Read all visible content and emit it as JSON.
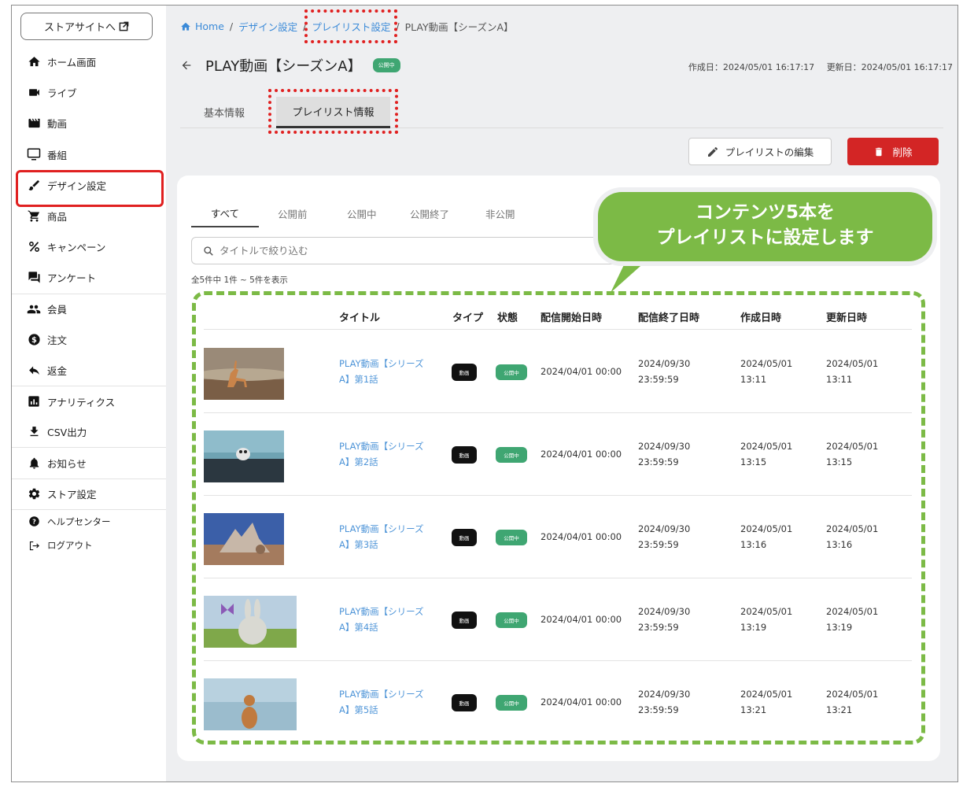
{
  "sidebar": {
    "store_button": "ストアサイトへ",
    "items": [
      {
        "label": "ホーム画面",
        "icon": "home-icon"
      },
      {
        "label": "ライブ",
        "icon": "video-camera-icon"
      },
      {
        "label": "動画",
        "icon": "clapperboard-icon"
      },
      {
        "label": "番組",
        "icon": "tv-icon"
      },
      {
        "label": "デザイン設定",
        "icon": "brush-icon"
      },
      {
        "label": "商品",
        "icon": "cart-icon"
      },
      {
        "label": "キャンペーン",
        "icon": "percent-icon"
      },
      {
        "label": "アンケート",
        "icon": "chat-icon"
      },
      {
        "label": "会員",
        "icon": "people-icon"
      },
      {
        "label": "注文",
        "icon": "dollar-icon"
      },
      {
        "label": "返金",
        "icon": "reply-icon"
      },
      {
        "label": "アナリティクス",
        "icon": "analytics-icon"
      },
      {
        "label": "CSV出力",
        "icon": "download-icon"
      },
      {
        "label": "お知らせ",
        "icon": "bell-icon"
      },
      {
        "label": "ストア設定",
        "icon": "gear-icon"
      }
    ],
    "help": "ヘルプセンター",
    "logout": "ログアウト"
  },
  "breadcrumb": {
    "home": "Home",
    "design": "デザイン設定",
    "playlist": "プレイリスト設定",
    "current": "PLAY動画【シーズンA】",
    "sep": "/"
  },
  "header": {
    "title": "PLAY動画【シーズンA】",
    "status": "公開中",
    "created": "作成日：2024/05/01 16:17:17",
    "updated": "更新日：2024/05/01 16:17:17"
  },
  "tabs": [
    "基本情報",
    "プレイリスト情報"
  ],
  "actions": {
    "edit": "プレイリストの編集",
    "delete": "削除"
  },
  "filter_tabs": [
    "すべて",
    "公開前",
    "公開中",
    "公開終了",
    "非公開"
  ],
  "search": {
    "placeholder": "タイトルで絞り込む"
  },
  "count_text": "全5件中 1件 ~ 5件を表示",
  "table": {
    "headers": [
      "タイトル",
      "タイプ",
      "状態",
      "配信開始日時",
      "配信終了日時",
      "作成日時",
      "更新日時"
    ],
    "rows": [
      {
        "title1": "PLAY動画【シリーズ",
        "title2": "A】第1話",
        "type": "動画",
        "state": "公開中",
        "start": "2024/04/01 00:00",
        "end1": "2024/09/30",
        "end2": "23:59:59",
        "created1": "2024/05/01",
        "created2": "13:11",
        "updated1": "2024/05/01",
        "updated2": "13:11"
      },
      {
        "title1": "PLAY動画【シリーズ",
        "title2": "A】第2話",
        "type": "動画",
        "state": "公開中",
        "start": "2024/04/01 00:00",
        "end1": "2024/09/30",
        "end2": "23:59:59",
        "created1": "2024/05/01",
        "created2": "13:15",
        "updated1": "2024/05/01",
        "updated2": "13:15"
      },
      {
        "title1": "PLAY動画【シリーズ",
        "title2": "A】第3話",
        "type": "動画",
        "state": "公開中",
        "start": "2024/04/01 00:00",
        "end1": "2024/09/30",
        "end2": "23:59:59",
        "created1": "2024/05/01",
        "created2": "13:16",
        "updated1": "2024/05/01",
        "updated2": "13:16"
      },
      {
        "title1": "PLAY動画【シリーズ",
        "title2": "A】第4話",
        "type": "動画",
        "state": "公開中",
        "start": "2024/04/01 00:00",
        "end1": "2024/09/30",
        "end2": "23:59:59",
        "created1": "2024/05/01",
        "created2": "13:19",
        "updated1": "2024/05/01",
        "updated2": "13:19"
      },
      {
        "title1": "PLAY動画【シリーズ",
        "title2": "A】第5話",
        "type": "動画",
        "state": "公開中",
        "start": "2024/04/01 00:00",
        "end1": "2024/09/30",
        "end2": "23:59:59",
        "created1": "2024/05/01",
        "created2": "13:21",
        "updated1": "2024/05/01",
        "updated2": "13:21"
      }
    ]
  },
  "callout": {
    "line1": "コンテンツ5本を",
    "line2": "プレイリストに設定します"
  },
  "colors": {
    "accent_green": "#7cba46",
    "status_green": "#3fa672",
    "danger": "#d32525",
    "link": "#3a8ad8",
    "highlight_red": "#e02020"
  }
}
